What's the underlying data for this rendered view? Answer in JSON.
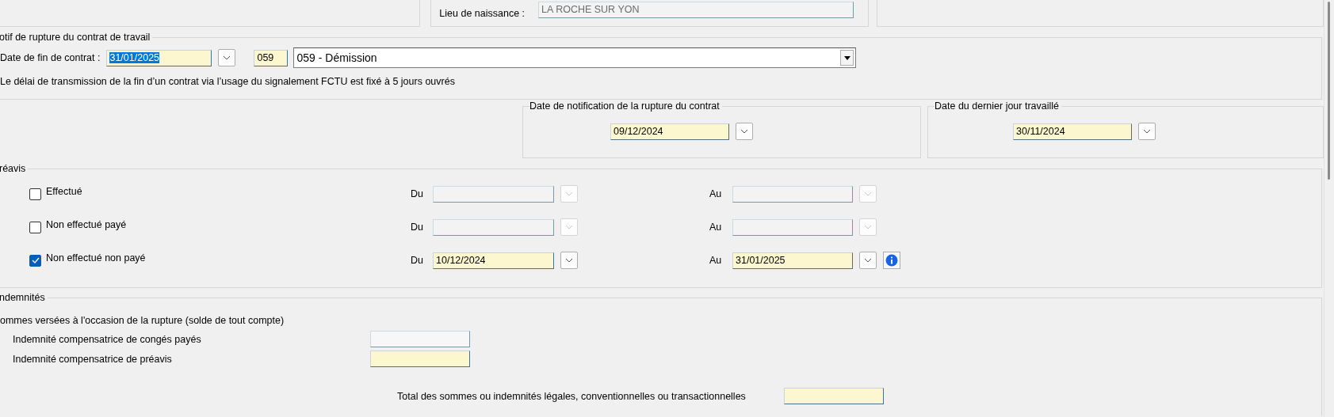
{
  "birth_place": {
    "label": "Lieu de naissance :",
    "value": "LA ROCHE SUR YON"
  },
  "termination": {
    "legend": "otif de rupture du contrat de travail",
    "end_date": {
      "label": "Date de fin de contrat :",
      "value": "31/01/2025",
      "text_selected": true
    },
    "code": "059",
    "reason": "059 - Démission",
    "notice": "Le délai de transmission de la fin d’un contrat via l’usage du signalement FCTU est fixé à 5 jours ouvrés"
  },
  "notification_date": {
    "legend": "Date de notification de la rupture du contrat",
    "value": "09/12/2024"
  },
  "last_day_worked": {
    "legend": "Date du dernier jour travaillé",
    "value": "30/11/2024"
  },
  "notice_period": {
    "legend": "réavis",
    "options": [
      {
        "label": "Effectué",
        "checked": false,
        "enabled": false,
        "info": false,
        "from": {
          "label": "Du"
        },
        "to": {
          "label": "Au"
        }
      },
      {
        "label": "Non effectué payé",
        "checked": false,
        "enabled": false,
        "info": false,
        "from": {
          "label": "Du"
        },
        "to": {
          "label": "Au"
        }
      },
      {
        "label": "Non effectué non payé",
        "checked": true,
        "enabled": true,
        "info": true,
        "from": {
          "label": "Du",
          "value": "10/12/2024"
        },
        "to": {
          "label": "Au",
          "value": "31/01/2025"
        }
      }
    ]
  },
  "indemnities": {
    "legend": "ndemnités",
    "subtitle": "ommes versées à l'occasion de la rupture (solde de tout compte)",
    "items": [
      {
        "label": "Indemnité compensatrice de congés payés",
        "disabled": true
      },
      {
        "label": "Indemnité compensatrice de préavis",
        "disabled": false
      }
    ],
    "total": {
      "label": "Total des sommes ou indemnités légales, conventionnelles ou transactionnelles",
      "disabled": false
    }
  }
}
